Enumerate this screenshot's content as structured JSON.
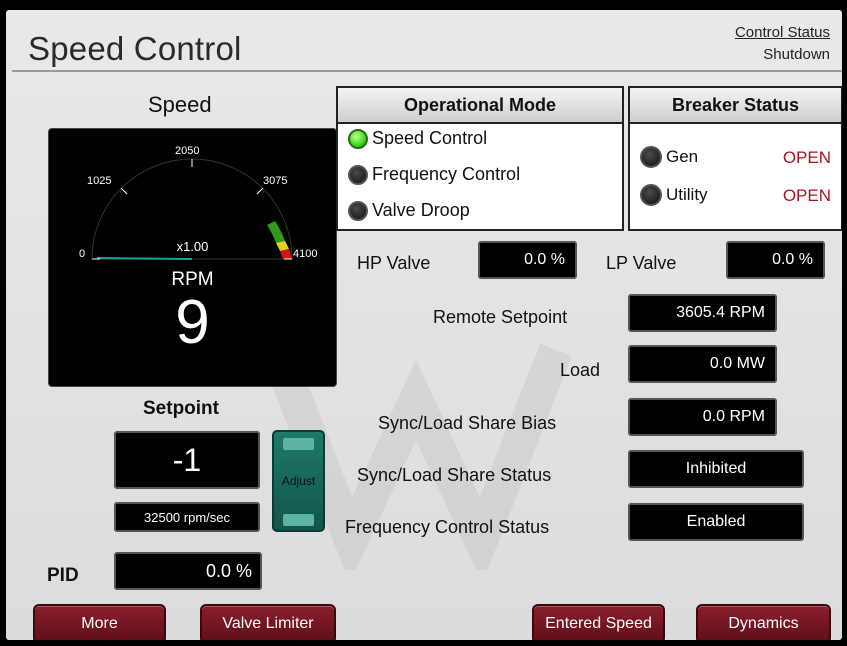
{
  "header": {
    "title": "Speed Control",
    "status_heading": "Control Status",
    "status_value": "Shutdown"
  },
  "speed": {
    "label": "Speed",
    "gauge": {
      "ticks": [
        "0",
        "1025",
        "2050",
        "3075",
        "4100"
      ],
      "multiplier": "x1.00",
      "unit": "RPM",
      "value": "9",
      "colors": {
        "arc": "#000000",
        "green": "#2e9b1a",
        "yellow": "#e6d21a",
        "red": "#d01818",
        "needle": "#1aa39a"
      }
    }
  },
  "setpoint": {
    "label": "Setpoint",
    "value": "-1",
    "rate": "32500 rpm/sec",
    "adjust_label": "Adjust"
  },
  "pid": {
    "label": "PID",
    "value": "0.0 %"
  },
  "operational_mode": {
    "heading": "Operational Mode",
    "modes": [
      {
        "label": "Speed Control",
        "active": true
      },
      {
        "label": "Frequency Control",
        "active": false
      },
      {
        "label": "Valve Droop",
        "active": false
      }
    ]
  },
  "breaker_status": {
    "heading": "Breaker Status",
    "items": [
      {
        "label": "Gen",
        "state": "OPEN"
      },
      {
        "label": "Utility",
        "state": "OPEN"
      }
    ]
  },
  "valves": {
    "hp_label": "HP Valve",
    "hp_value": "0.0 %",
    "lp_label": "LP Valve",
    "lp_value": "0.0 %"
  },
  "readouts": {
    "remote_setpoint": {
      "label": "Remote Setpoint",
      "value": "3605.4 RPM"
    },
    "load": {
      "label": "Load",
      "value": "0.0 MW"
    },
    "bias": {
      "label": "Sync/Load Share Bias",
      "value": "0.0 RPM"
    },
    "sync_status": {
      "label": "Sync/Load Share Status",
      "value": "Inhibited"
    },
    "freq_status": {
      "label": "Frequency Control Status",
      "value": "Enabled"
    }
  },
  "buttons": {
    "more": "More",
    "valve_limiter": "Valve Limiter",
    "entered_speed": "Entered Speed",
    "dynamics": "Dynamics"
  },
  "colors": {
    "accent_button": "#7a1a26",
    "status_open": "#a01824",
    "led_active": "#3ddc18",
    "adjust_button": "#1e7a6b"
  }
}
